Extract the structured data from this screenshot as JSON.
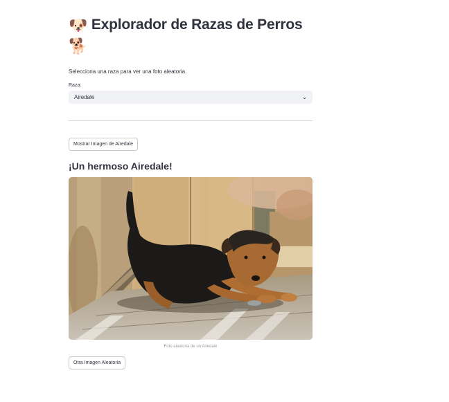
{
  "page": {
    "title": "Explorador de Razas de Perros",
    "title_icon": "dog-face-icon",
    "title_icon2": "dog-icon",
    "intro": "Selecciona una raza para ver una foto aleatoria."
  },
  "breed_select": {
    "label": "Raza:",
    "value": "Airedale"
  },
  "buttons": {
    "show": "Mostrar Imagen de Airedale",
    "another": "Otra Imagen Aleatoria"
  },
  "result": {
    "heading": "¡Un hermoso Airedale!",
    "image_caption": "Foto aleatoria de un Airedale"
  },
  "colors": {
    "text": "#31333f",
    "select_bg": "#f0f2f6",
    "caption": "#9a9ba3"
  }
}
